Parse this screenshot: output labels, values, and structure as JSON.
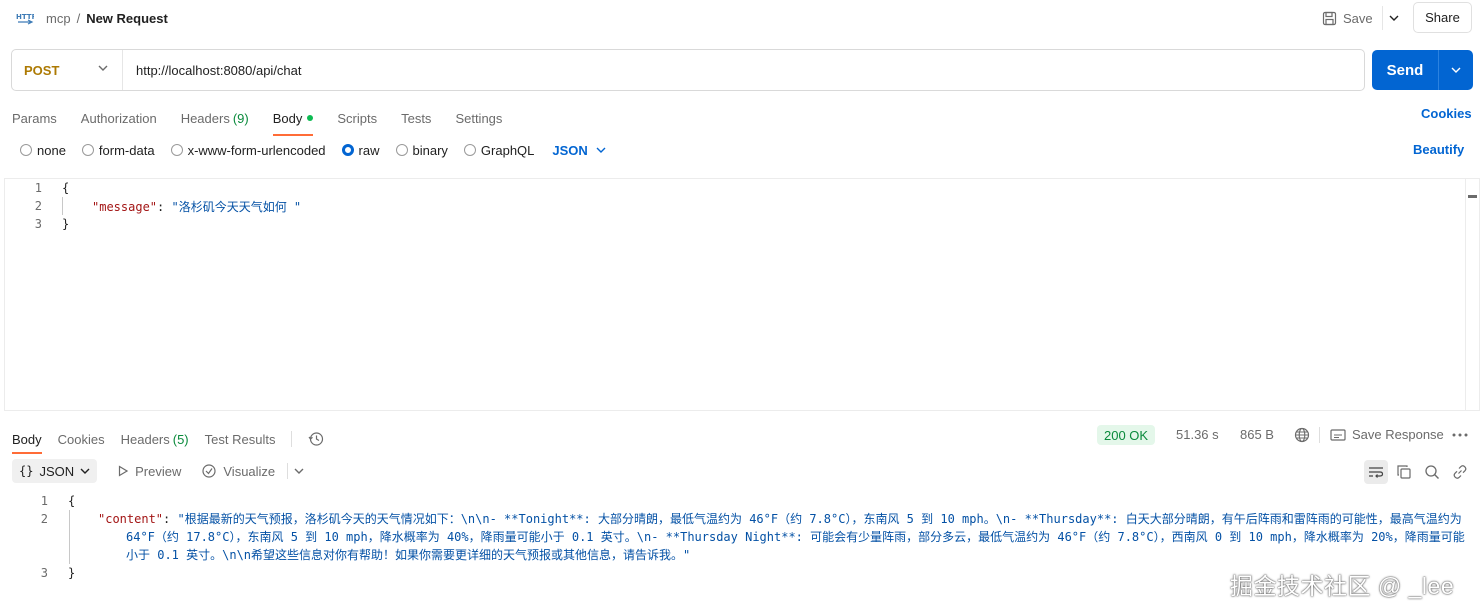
{
  "breadcrumb": {
    "collection": "mcp",
    "separator": "/",
    "request": "New Request"
  },
  "toolbar": {
    "save_label": "Save",
    "share_label": "Share"
  },
  "request": {
    "method": "POST",
    "url": "http://localhost:8080/api/chat",
    "send_label": "Send"
  },
  "request_tabs": [
    {
      "label": "Params"
    },
    {
      "label": "Authorization"
    },
    {
      "label": "Headers",
      "count": "(9)"
    },
    {
      "label": "Body",
      "active": true
    },
    {
      "label": "Scripts"
    },
    {
      "label": "Tests"
    },
    {
      "label": "Settings"
    }
  ],
  "cookies_label": "Cookies",
  "body_types": [
    "none",
    "form-data",
    "x-www-form-urlencoded",
    "raw",
    "binary",
    "GraphQL"
  ],
  "body_type_selected": "raw",
  "body_format": "JSON",
  "beautify_label": "Beautify",
  "request_body": {
    "line1": "{",
    "key": "\"message\"",
    "colon": ": ",
    "value": "\"洛杉矶今天天气如何 \"",
    "line3": "}",
    "line_numbers": [
      "1",
      "2",
      "3"
    ]
  },
  "response_tabs": [
    {
      "label": "Body",
      "active": true
    },
    {
      "label": "Cookies"
    },
    {
      "label": "Headers",
      "count": "(5)"
    },
    {
      "label": "Test Results"
    }
  ],
  "response_meta": {
    "status": "200 OK",
    "time": "51.36 s",
    "size": "865 B",
    "save_response_label": "Save Response"
  },
  "response_tools": {
    "format": "JSON",
    "preview_label": "Preview",
    "visualize_label": "Visualize"
  },
  "response_body": {
    "line1": "{",
    "key": "\"content\"",
    "colon": ": ",
    "value": "\"根据最新的天气预报，洛杉矶今天的天气情况如下：\\n\\n- **Tonight**: 大部分晴朗，最低气温约为 46°F（约 7.8°C），东南风 5 到 10 mph。\\n- **Thursday**: 白天大部分晴朗，有午后阵雨和雷阵雨的可能性，最高气温约为 64°F（约 17.8°C），东南风 5 到 10 mph，降水概率为 40%，降雨量可能小于 0.1 英寸。\\n- **Thursday Night**: 可能会有少量阵雨，部分多云，最低气温约为 46°F（约 7.8°C），西南风 0 到 10 mph，降水概率为 20%，降雨量可能小于 0.1 英寸。\\n\\n希望这些信息对你有帮助！如果你需要更详细的天气预报或其他信息，请告诉我。\"",
    "line3": "}",
    "line_numbers": [
      "1",
      "2",
      "3"
    ]
  },
  "watermark": "掘金技术社区 @ _lee",
  "colors": {
    "accent": "#0265d2",
    "method": "#ad7a03",
    "tab_active": "#ff6c37",
    "status_ok": "#0a8a3c"
  }
}
